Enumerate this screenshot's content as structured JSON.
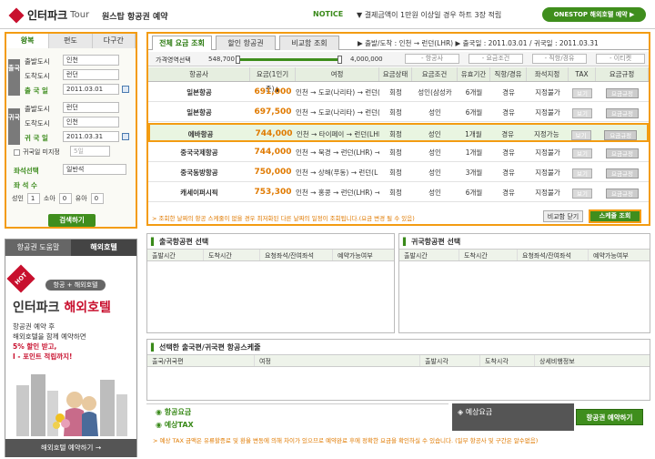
{
  "header": {
    "logo_text": "인터파크",
    "logo_sub": "Tour",
    "subtitle": "원스탑 항공권 예약",
    "notice_label": "NOTICE",
    "notice_text": "▼ 결제금액이 1만원 이상일 경우 하트 3장 적립",
    "onestop_button": "ONESTOP 해외호텔 예약 ▶"
  },
  "search": {
    "tabs": [
      "왕복",
      "편도",
      "다구간"
    ],
    "outbound_side": "출국",
    "return_side": "귀국",
    "depart_city_label": "출발도시",
    "arrive_city_label": "도착도시",
    "depart_date_label": "출 국 일",
    "return_date_label": "귀 국 일",
    "out_from": "인천",
    "out_to": "런던",
    "out_date": "2011.03.01",
    "ret_from": "런던",
    "ret_to": "인천",
    "ret_date": "2011.03.31",
    "return_undecided": "귀국일 미지정",
    "days_select": "5일",
    "seat_label": "좌석선택",
    "seat_value": "일반석",
    "pax_label": "좌 석 수",
    "adult_label": "성인",
    "adult_count": "1",
    "child_label": "소아",
    "child_count": "0",
    "infant_label": "유아",
    "infant_count": "0",
    "search_button": "검색하기"
  },
  "ad": {
    "tabs": [
      "항공권 도움말",
      "해외호텔"
    ],
    "hot": "HOT",
    "pill": "항공 + 해외호텔",
    "brand": "인터파크",
    "brand_product": "해외호텔",
    "line1": "항공권 예약 후",
    "line2": "해외호텔을 함께 예약하면",
    "line3": "5% 할인 받고,",
    "line4": "I - 포인트 적립까지!",
    "footer": "해외호텔 예약하기 →"
  },
  "main": {
    "tabs": [
      "전체 요금 조회",
      "할인 항공권",
      "비교함 조회"
    ],
    "route": "▶ 출발/도착 : 인천 → 런던(LHR)   ▶ 출국일 : 2011.03.01 / 귀국일 : 2011.03.31",
    "price_range_label": "가격영역선택",
    "price_min": "548,700",
    "price_max": "4,000,000",
    "filters": [
      "- 항공사",
      "- 요금조건",
      "- 직항/경유",
      "- 이티켓"
    ],
    "columns": [
      "항공사",
      "요금(1인기준)▲",
      "여정",
      "요금상태",
      "요금조건",
      "유효기간",
      "직항/경유",
      "좌석지정",
      "TAX",
      "요금규정"
    ],
    "rows": [
      {
        "airline": "일본항공",
        "price": "691,000",
        "itinerary": "인천 → 도쿄(나리타) → 런던(",
        "status": "회정",
        "cond": "성인(삼성카",
        "valid": "6개월",
        "via": "경유",
        "seat": "지정불가",
        "tax": "보기",
        "rule": "요금규정"
      },
      {
        "airline": "일본항공",
        "price": "697,500",
        "itinerary": "인천 → 도쿄(나리타) → 런던(",
        "status": "회정",
        "cond": "성인",
        "valid": "6개월",
        "via": "경유",
        "seat": "지정불가",
        "tax": "보기",
        "rule": "요금규정"
      },
      {
        "airline": "에바항공",
        "price": "744,000",
        "itinerary": "인천 → 타이페이 → 런던(LHR)",
        "status": "회정",
        "cond": "성인",
        "valid": "1개월",
        "via": "경유",
        "seat": "지정가능",
        "tax": "보기",
        "rule": "요금규정"
      },
      {
        "airline": "중국국제항공",
        "price": "744,000",
        "itinerary": "인천 → 북경 → 런던(LHR) →",
        "status": "회정",
        "cond": "성인",
        "valid": "1개월",
        "via": "경유",
        "seat": "지정불가",
        "tax": "보기",
        "rule": "요금규정"
      },
      {
        "airline": "중국동방항공",
        "price": "750,000",
        "itinerary": "인천 → 상해(푸동) → 런던(L",
        "status": "회정",
        "cond": "성인",
        "valid": "3개월",
        "via": "경유",
        "seat": "지정불가",
        "tax": "보기",
        "rule": "요금규정"
      },
      {
        "airline": "캐세이퍼시픽",
        "price": "753,300",
        "itinerary": "인천 → 홍콩 → 런던(LHR) →",
        "status": "회정",
        "cond": "성인",
        "valid": "6개월",
        "via": "경유",
        "seat": "지정불가",
        "tax": "보기",
        "rule": "요금규정"
      }
    ],
    "note": "> 조회한 날짜의 항공 스케줄이 없을 경우 최저화된 다른 날짜의 일정이 조회됩니다.(요금 변경 될 수 있음)",
    "compare_close": "비교함 닫기",
    "schedule_button": "스케줄 조회"
  },
  "outbound_panel": {
    "title": "출국항공편 선택",
    "columns": [
      "출발시간",
      "도착시간",
      "요청좌석/잔여좌석",
      "예약가능여부"
    ]
  },
  "return_panel": {
    "title": "귀국항공편 선택",
    "columns": [
      "출발시간",
      "도착시간",
      "요청좌석/잔여좌석",
      "예약가능여부"
    ]
  },
  "schedule_panel": {
    "title": "선택한 출국편/귀국편 항공스케줄",
    "columns": [
      "출국/귀국편",
      "여정",
      "출발시각",
      "도착시각",
      "상세비행정보"
    ]
  },
  "bottom": {
    "fare_label": "항공요금",
    "tax_label": "예상TAX",
    "expected_label": "예상요금",
    "book_button": "항공권 예약하기",
    "note": "> 예상 TAX 금액은 유류할증료 및 환율 변동에 의해 차이가 있으므로 예약완료 후에 정확한 요금을 확인하실 수 있습니다. (일부 항공사 및 구간은 알수없음)"
  },
  "colors": {
    "accent_green": "#3f8e1d",
    "highlight_orange": "#f39c12",
    "price_orange": "#e07a00"
  },
  "icons": [
    "calendar-icon",
    "user-icon",
    "dropdown-icon"
  ]
}
